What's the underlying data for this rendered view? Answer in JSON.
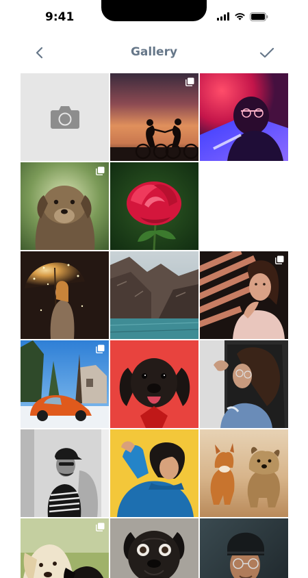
{
  "status_bar": {
    "time": "9:41"
  },
  "header": {
    "title": "Gallery",
    "back_icon": "chevron-left-icon",
    "confirm_icon": "checkmark-icon"
  },
  "colors": {
    "title": "#667789",
    "icon": "#667789",
    "camera_tile_bg": "#e6e6e6",
    "camera_icon": "#8d8d8d"
  },
  "gallery": {
    "tiles": [
      {
        "kind": "camera",
        "icon": "camera-icon"
      },
      {
        "kind": "photo",
        "subject": "couple-on-bicycles-sunset",
        "multi": true
      },
      {
        "kind": "photo",
        "subject": "man-neon-light",
        "multi": false
      },
      {
        "kind": "photo",
        "subject": "puppy",
        "multi": true
      },
      {
        "kind": "photo",
        "subject": "red-rose",
        "multi": false
      },
      {
        "kind": "empty"
      },
      {
        "kind": "photo",
        "subject": "woman-umbrella-lights",
        "multi": false
      },
      {
        "kind": "photo",
        "subject": "mountain-lake",
        "multi": false
      },
      {
        "kind": "photo",
        "subject": "woman-pink-sweater",
        "multi": true
      },
      {
        "kind": "photo",
        "subject": "orange-beetle-car",
        "multi": true
      },
      {
        "kind": "photo",
        "subject": "black-dog-red-background",
        "multi": false
      },
      {
        "kind": "photo",
        "subject": "curly-hair-woman",
        "multi": false
      },
      {
        "kind": "photo",
        "subject": "man-cap-monochrome",
        "multi": false
      },
      {
        "kind": "photo",
        "subject": "boy-blue-shirt-yellow",
        "multi": false
      },
      {
        "kind": "photo",
        "subject": "two-dogs-running",
        "multi": false
      },
      {
        "kind": "photo",
        "subject": "two-dogs-close",
        "multi": true
      },
      {
        "kind": "photo",
        "subject": "pug",
        "multi": false
      },
      {
        "kind": "photo",
        "subject": "man-beanie-glasses",
        "multi": false
      }
    ]
  }
}
